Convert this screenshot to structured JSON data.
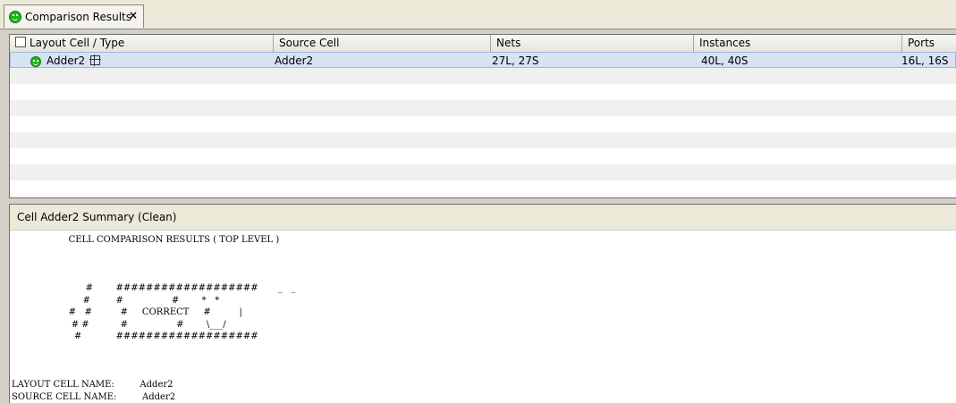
{
  "tab": {
    "title": "Comparison Results",
    "close": "×"
  },
  "table": {
    "headers": [
      "Layout Cell / Type",
      "Source Cell",
      "Nets",
      "Instances",
      "Ports"
    ],
    "rows": [
      {
        "layout": "Adder2",
        "source": "Adder2",
        "nets": "27L, 27S",
        "instances": "40L, 40S",
        "ports": "16L, 16S"
      }
    ]
  },
  "summary": {
    "title": "Cell Adder2 Summary (Clean)",
    "report": "                    CELL COMPARISON RESULTS ( TOP LEVEL )\n\n\n\n                          #        ###################       _   _\n                         #         #                 #        *   *\n                    #   #          #     CORRECT     #          |\n                     # #           #                 #        \\___/\n                      #            ###################\n\n\n\nLAYOUT CELL NAME:         Adder2\nSOURCE CELL NAME:         Adder2"
  },
  "colors": {
    "selection": "#d7e2f2",
    "status_ok": "#1fb51f"
  }
}
